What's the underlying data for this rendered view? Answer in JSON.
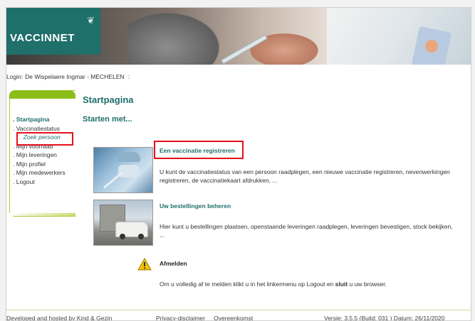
{
  "app": {
    "logo_text": "VACCINNET"
  },
  "login": {
    "label": "Login:",
    "user": "De Wispelaere Ingmar - MECHELEN",
    "suffix": ":"
  },
  "sidebar": {
    "items": [
      {
        "label": "Startpagina"
      },
      {
        "label": "Vaccinatiestatus"
      },
      {
        "label": "Zoek persoon"
      },
      {
        "label": "Mijn voorraad"
      },
      {
        "label": "Mijn leveringen"
      },
      {
        "label": "Mijn profiel"
      },
      {
        "label": "Mijn medewerkers"
      },
      {
        "label": "Logout"
      }
    ]
  },
  "main": {
    "title": "Startpagina",
    "subtitle": "Starten met...",
    "sections": [
      {
        "link": "Een vaccinatie registreren",
        "description": "U kunt de vaccinatiestatus van een persoon raadplegen, een nieuwe vaccinatie registreren, nevenwerkingen registreren, de vaccinatiekaart afdrukken, ..."
      },
      {
        "link": "Uw bestellingen beheren",
        "description": "Hier kunt u bestellingen plaatsen, openstaande leveringen raadplegen, leveringen bevestigen, stock bekijken, ..."
      },
      {
        "link": "Afmelden",
        "description_pre": "Om u volledig af te melden klikt u in het linkermenu op Logout en ",
        "description_bold": "sluit",
        "description_post": " u uw browser."
      }
    ]
  },
  "footer": {
    "hosted": "Developed and hosted by Kind & Gezin",
    "privacy": "Privacy-disclaimer",
    "agreement": "Overeenkomst",
    "version": "Versie: 3.5.5 (Build: 031 ) Datum: 26/11/2020"
  },
  "colors": {
    "brand_teal": "#1f6f6b",
    "sidebar_green": "#8cbd18",
    "highlight_red": "#e6101a"
  },
  "icons": {
    "warning": "warning-icon",
    "logo_leaf": "leaf-icon"
  }
}
